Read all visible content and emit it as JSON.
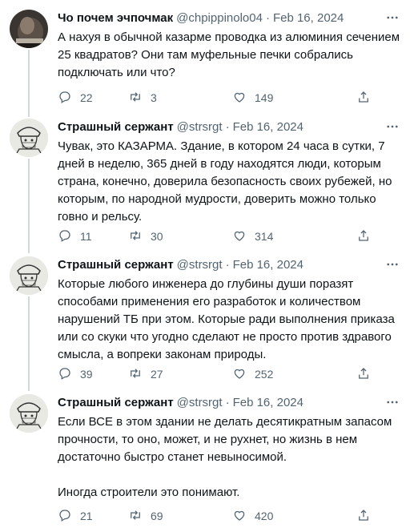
{
  "tweets": [
    {
      "name": "Чо почем эчпочмак",
      "handle": "@chpippinolo04",
      "separator": "·",
      "date": "Feb 16, 2024",
      "text": "А нахуя в обычной казарме проводка из алюминия сечением 25 квадратов? Они там муфельные печки собрались подключать или что?",
      "replies": "22",
      "retweets": "3",
      "likes": "149",
      "avatar": "dark-avatar-photo"
    },
    {
      "name": "Страшный сержант",
      "handle": "@strsrgt",
      "separator": "·",
      "date": "Feb 16, 2024",
      "text": "Чувак, это КАЗАРМА. Здание, в котором 24 часа в сутки, 7 дней в неделю, 365 дней в году находятся люди, которым страна, конечно, доверила безопасность своих рубежей, но которым, по народной мудрости, доверить можно только говно и рельсу.",
      "replies": "11",
      "retweets": "30",
      "likes": "314",
      "avatar": "soldier-sketch-avatar"
    },
    {
      "name": "Страшный сержант",
      "handle": "@strsrgt",
      "separator": "·",
      "date": "Feb 16, 2024",
      "text": "Которые любого инженера до глубины души поразят способами применения его разработок и количеством нарушений ТБ при этом. Которые ради выполнения приказа или со скуки что угодно сделают не просто против здравого смысла, а вопреки законам природы.",
      "replies": "39",
      "retweets": "27",
      "likes": "252",
      "avatar": "soldier-sketch-avatar"
    },
    {
      "name": "Страшный сержант",
      "handle": "@strsrgt",
      "separator": "·",
      "date": "Feb 16, 2024",
      "text": "Если ВСЕ в этом здании не делать десятикратным запасом прочности, то оно, может, и не рухнет, но жизнь в нем достаточно быстро станет невыносимой.\n\nИногда строители это понимают.",
      "replies": "21",
      "retweets": "69",
      "likes": "420",
      "avatar": "soldier-sketch-avatar"
    }
  ],
  "colors": {
    "text": "#0f1419",
    "secondary": "#536471",
    "thread_line": "#cfd9de"
  },
  "icons": [
    "reply-icon",
    "retweet-icon",
    "like-icon",
    "share-icon",
    "more-icon"
  ]
}
